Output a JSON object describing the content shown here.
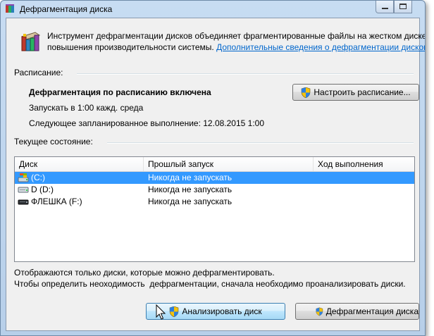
{
  "window": {
    "title": "Дефрагментация диска"
  },
  "intro": {
    "text_line1": "Инструмент дефрагментации дисков объединяет фрагментированные файлы на жестком диске",
    "text_line2": "повышения производительности системы.",
    "link": "Дополнительные сведения о дефрагментации дисков"
  },
  "schedule": {
    "section_label": "Расписание:",
    "status": "Дефрагментация по расписанию включена",
    "run_info": "Запускать в 1:00 кажд. среда",
    "next_run": "Следующее запланированное выполнение: 12.08.2015 1:00",
    "configure_button": "Настроить расписание..."
  },
  "current": {
    "section_label": "Текущее состояние:",
    "columns": [
      "Диск",
      "Прошлый запуск",
      "Ход выполнения"
    ],
    "rows": [
      {
        "disk": "(C:)",
        "last_run": "Никогда не запускать",
        "progress": "",
        "icon": "system-drive-icon"
      },
      {
        "disk": "D (D:)",
        "last_run": "Никогда не запускать",
        "progress": "",
        "icon": "hard-drive-icon"
      },
      {
        "disk": "ФЛЕШКА (F:)",
        "last_run": "Никогда не запускать",
        "progress": "",
        "icon": "usb-drive-icon"
      }
    ]
  },
  "notes": {
    "line1": "Отображаются только диски, которые можно дефрагментировать.",
    "line2": "Чтобы определить неоходимость  дефрагментации, сначала необходимо проанализировать диски."
  },
  "actions": {
    "analyze_button": "Анализировать диск",
    "defrag_button": "Дефрагментация диска"
  },
  "colors": {
    "selection": "#3399ff",
    "link": "#0066cc",
    "titlebar": "#c7dcf2"
  }
}
